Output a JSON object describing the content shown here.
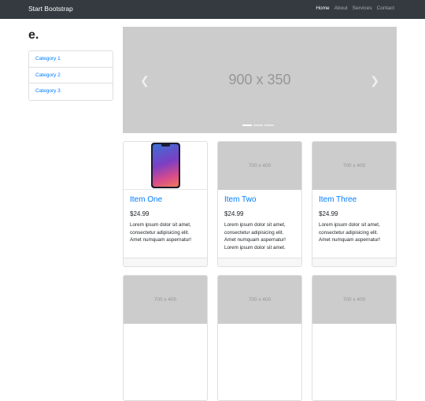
{
  "navbar": {
    "brand": "Start Bootstrap",
    "links": [
      {
        "label": "Home",
        "active": true
      },
      {
        "label": "About",
        "active": false
      },
      {
        "label": "Services",
        "active": false
      },
      {
        "label": "Contact",
        "active": false
      }
    ]
  },
  "sidebar": {
    "title": "e.",
    "categories": [
      "Category 1",
      "Category 2",
      "Category 3"
    ]
  },
  "carousel": {
    "image_text": "900 x 350",
    "prev_icon": "chevron-left-icon",
    "next_icon": "chevron-right-icon",
    "indicators": 3,
    "active_indicator": 0
  },
  "products": [
    {
      "name": "Item One",
      "price": "$24.99",
      "description": "Lorem ipsum dolor sit amet, consectetur adipisicing elit. Amet numquam aspernatur!",
      "image_text": "",
      "image": "smartphone-photo"
    },
    {
      "name": "Item Two",
      "price": "$24.99",
      "description": "Lorem ipsum dolor sit amet, consectetur adipisicing elit. Amet numquam aspernatur! Lorem ipsum dolor sit amet.",
      "image_text": "700 x 400"
    },
    {
      "name": "Item Three",
      "price": "$24.99",
      "description": "Lorem ipsum dolor sit amet, consectetur adipisicing elit. Amet numquam aspernatur!",
      "image_text": "700 x 400"
    },
    {
      "image_text": "700 x 400"
    },
    {
      "image_text": "700 x 400"
    },
    {
      "image_text": "700 x 400"
    }
  ],
  "colors": {
    "navbar_bg": "#343a40",
    "link": "#007bff",
    "placeholder_bg": "#cccccc"
  }
}
